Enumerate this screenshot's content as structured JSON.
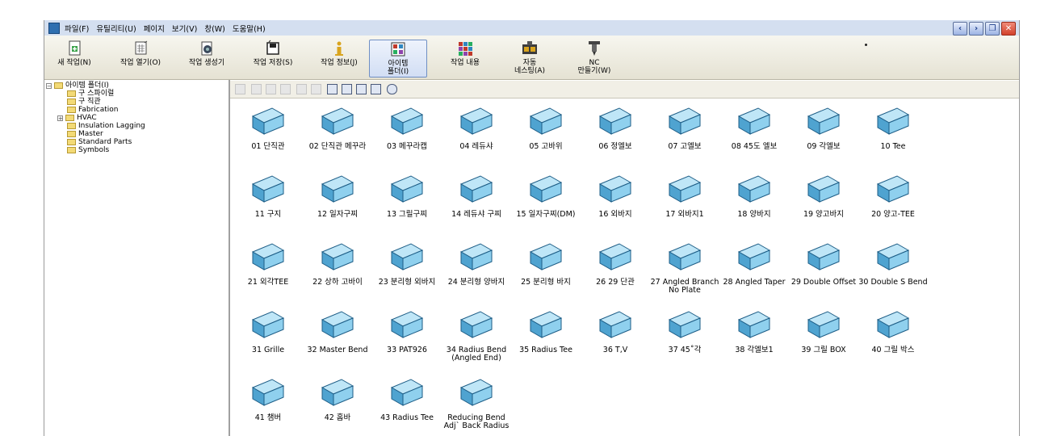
{
  "window": {
    "menu": [
      "파일(F)",
      "유틸리티(U)",
      "페이지",
      "보기(V)",
      "창(W)",
      "도움말(H)"
    ],
    "controls": [
      "‹",
      "›",
      "❐",
      "✕"
    ]
  },
  "toolbar": [
    {
      "label": "새 작업(N)",
      "icon": "new-job-icon"
    },
    {
      "label": "작업 열기(O)",
      "icon": "open-job-icon"
    },
    {
      "label": "작업 생성기",
      "icon": "job-generator-icon"
    },
    {
      "label": "작업 저장(S)",
      "icon": "save-job-icon"
    },
    {
      "label": "작업 정보(J)",
      "icon": "job-info-icon"
    },
    {
      "label": "아이템\n폴더(I)",
      "icon": "item-folder-icon",
      "active": true
    },
    {
      "label": "작업 내용",
      "icon": "job-contents-icon"
    },
    {
      "label": "자동\n네스팅(A)",
      "icon": "auto-nesting-icon"
    },
    {
      "label": "NC\n만들기(W)",
      "icon": "nc-make-icon"
    }
  ],
  "tree": {
    "root": "아이템 폴더(I)",
    "items": [
      "구 스파이럴",
      "구 직관",
      "Fabrication",
      "HVAC",
      "Insulation Lagging",
      "Master",
      "Standard Parts",
      "Symbols"
    ]
  },
  "items": [
    "01 단직관",
    "02 단직관 메꾸라",
    "03 메꾸라캡",
    "04 레듀샤",
    "05 고바위",
    "06 정엘보",
    "07 고엘보",
    "08 45도 엘보",
    "09 각엘보",
    "10 Tee",
    "11 구지",
    "12 일자구찌",
    "13 그릴구찌",
    "14 레듀샤 구찌",
    "15 일자구찌(DM)",
    "16 외바지",
    "17 외바지1",
    "18 양바지",
    "19 양고바지",
    "20 양고-TEE",
    "21 외각TEE",
    "22 상하 고바이",
    "23 분리형 외바지",
    "24 분리형 양바지",
    "25 분리형 바지",
    "26 29 단관",
    "27 Angled Branch\nNo Plate",
    "28 Angled Taper",
    "29 Double Offset",
    "30 Double S Bend",
    "31 Grille",
    "32 Master Bend",
    "33 PAT926",
    "34 Radius Bend\n(Angled End)",
    "35 Radius Tee",
    "36 T,V",
    "37 45˚각",
    "38 각엘보1",
    "39 그릴 BOX",
    "40 그릴 박스",
    "41 챔버",
    "42 홈바",
    "43 Radius Tee",
    "Reducing Bend\nAdj` Back Radius"
  ],
  "colors": {
    "duct_face": "#8fd0ee",
    "duct_top": "#bfe6f7",
    "duct_side": "#4fa3d0",
    "duct_edge": "#1d5d86"
  }
}
